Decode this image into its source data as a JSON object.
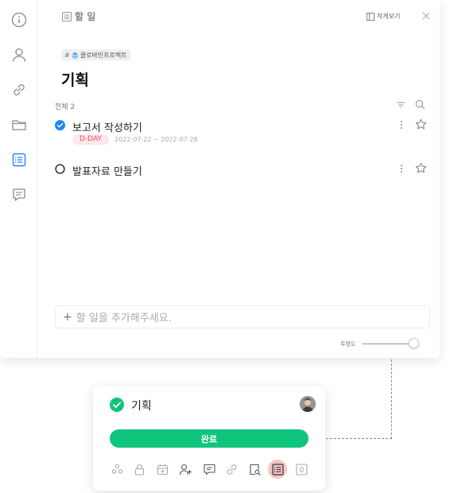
{
  "header": {
    "title": "할 일",
    "view_label": "작게보기"
  },
  "project_tag": {
    "hash": "#",
    "name": "클로바인프로젝트"
  },
  "page_title": "기획",
  "list": {
    "count_label": "전체 2"
  },
  "tasks": [
    {
      "title": "보고서 작성하기",
      "done": true,
      "dday": "D-DAY",
      "dates": "2022-07-22 ~ 2022-07-28"
    },
    {
      "title": "발표자료 만들기",
      "done": false
    }
  ],
  "add_task": {
    "placeholder": "할 일을 추가해주세요."
  },
  "opacity": {
    "label": "투명도",
    "value": 0.9
  },
  "card": {
    "title": "기획",
    "done_label": "완료"
  },
  "colors": {
    "accent_green": "#0fc57c",
    "check_blue": "#1e88f5",
    "dday_red": "#e8555f",
    "active_icon_bg": "#f7c5c8"
  },
  "rail_icons": [
    "info-icon",
    "person-icon",
    "link-icon",
    "folder-icon",
    "list-icon",
    "comment-icon"
  ],
  "card_tools": [
    "subtask-icon",
    "lock-icon",
    "calendar-icon",
    "assign-user-icon",
    "comment-icon",
    "link-icon",
    "search-doc-icon",
    "list-icon",
    "count-icon"
  ]
}
